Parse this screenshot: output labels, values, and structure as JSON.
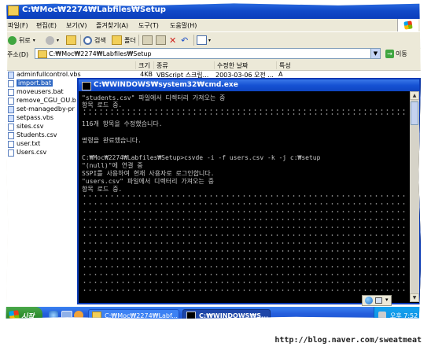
{
  "explorer": {
    "title": "C:₩Moc₩2274₩Labfiles₩Setup",
    "menu": [
      "파일(F)",
      "편집(E)",
      "보기(V)",
      "즐겨찾기(A)",
      "도구(T)",
      "도움말(H)"
    ],
    "toolbar": {
      "back_label": "뒤로",
      "search_label": "검색",
      "folders_label": "폴더"
    },
    "address": {
      "label": "주소(D)",
      "value": "C:₩Moc₩2274₩Labfiles₩Setup",
      "go_label": "이동"
    },
    "columns": [
      "크기",
      "종류",
      "수정한 날짜",
      "특성"
    ],
    "files": [
      {
        "name": "adminfullcontrol.vbs",
        "size": "4KB",
        "type": "VBScript 스크립...",
        "date": "2003-03-06 오전 ...",
        "attr": "A",
        "icon": "script-file-icon"
      },
      {
        "name": "import.bat",
        "icon": "batch-file-icon",
        "selected": true
      },
      {
        "name": "moveusers.bat",
        "icon": "batch-file-icon"
      },
      {
        "name": "remove_CGU_OU.b",
        "icon": "batch-file-icon"
      },
      {
        "name": "set-managedby-pr",
        "icon": "script-file-icon"
      },
      {
        "name": "setpass.vbs",
        "icon": "script-file-icon"
      },
      {
        "name": "sites.csv",
        "icon": "csv-file-icon"
      },
      {
        "name": "Students.csv",
        "icon": "csv-file-icon"
      },
      {
        "name": "user.txt",
        "icon": "text-file-icon"
      },
      {
        "name": "Users.csv",
        "icon": "csv-file-icon"
      }
    ]
  },
  "cmd": {
    "title": "C:₩WINDOWS₩system32₩cmd.exe",
    "lines": [
      "\"students.csv\" 파일에서 디렉터리 가져오는 중",
      "항목 로드 중.",
      "",
      "116개 항목을 수정했습니다.",
      "",
      "명령을 완료했습니다.",
      "",
      "C:₩Moc₩2274₩Labfiles₩Setup>csvde -i -f users.csv -k -j c:₩setup",
      "\"(null)\"에 연결 중",
      "SSPI를 사용하여 현재 사용자로 로그인합니다.",
      "\"users.csv\" 파일에서 디렉터리 가져오는 중",
      "항목 로드 중."
    ]
  },
  "taskbar": {
    "start_label": "시작",
    "tasks": [
      {
        "label": "C:₩Moc₩2274₩Labf..."
      },
      {
        "label": "C:₩WINDOWS₩S..."
      }
    ],
    "clock": "오후 7:52"
  },
  "watermark": "http://blog.naver.com/sweatmeat"
}
